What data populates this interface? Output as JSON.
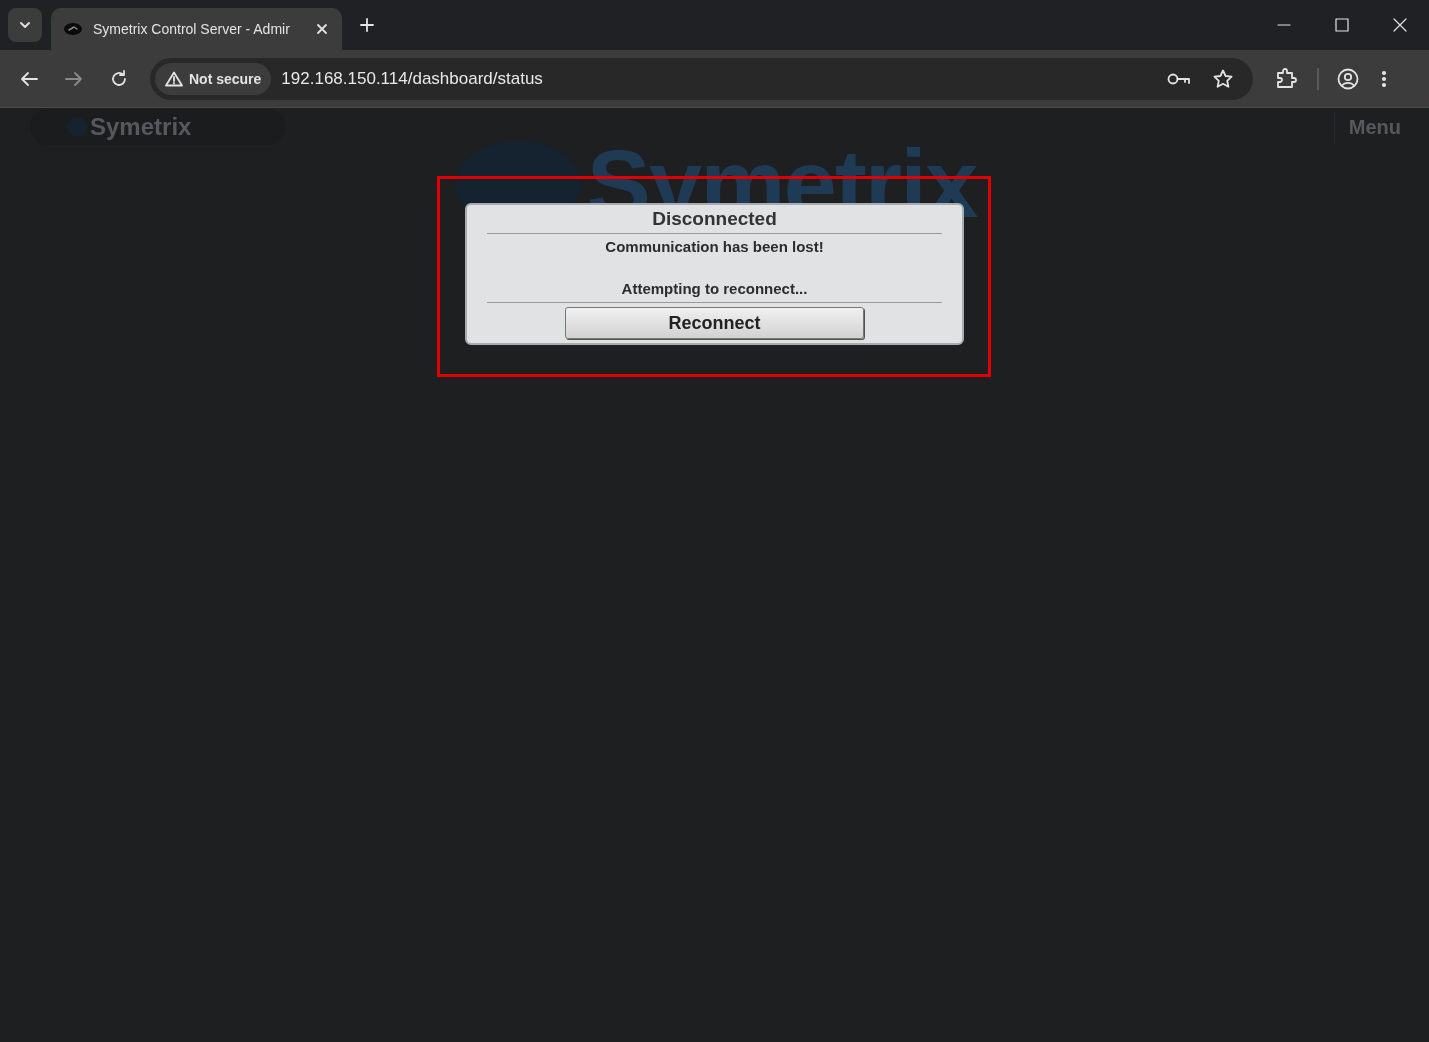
{
  "browser": {
    "tab": {
      "title": "Symetrix Control Server - Admir",
      "selected": true
    },
    "security_label": "Not secure",
    "url": "192.168.150.114/dashboard/status"
  },
  "page": {
    "header": {
      "logo": "Symetrix",
      "menu": "Menu"
    },
    "watermark_logo": "Symetrix"
  },
  "dialog": {
    "title": "Disconnected",
    "message": "Communication has been lost!",
    "status": "Attempting to reconnect...",
    "button": "Reconnect",
    "highlighted": true
  }
}
